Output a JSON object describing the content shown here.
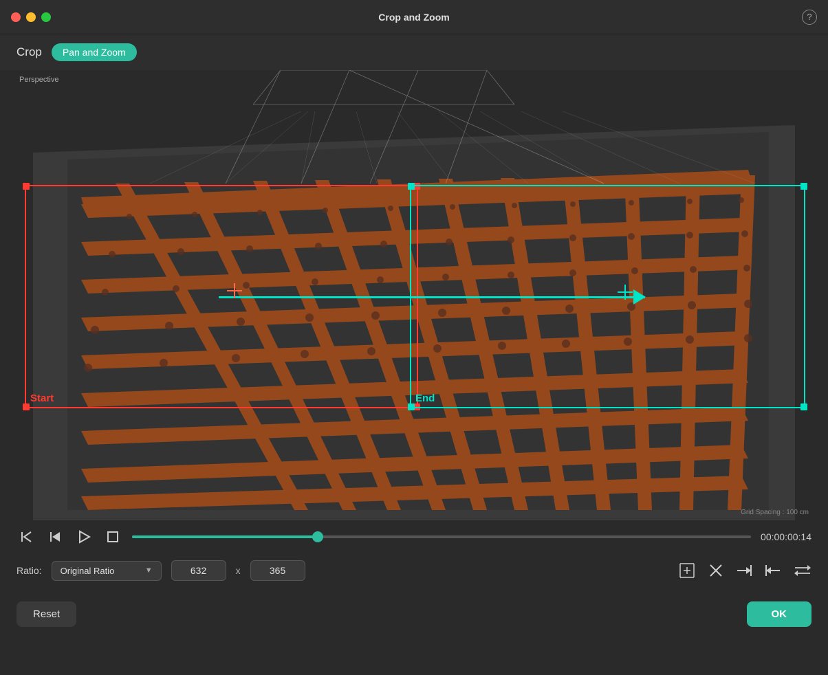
{
  "titlebar": {
    "title": "Crop and Zoom",
    "help_icon": "?"
  },
  "tabs": {
    "crop_label": "Crop",
    "panzoom_label": "Pan and Zoom"
  },
  "viewport": {
    "label": "Perspective",
    "grid_spacing": "Grid Spacing : 100 cm",
    "start_label": "Start",
    "end_label": "End"
  },
  "playback": {
    "rewind_icon": "⇐",
    "step_back_icon": "⊳|",
    "play_icon": "▷",
    "stop_icon": "□",
    "time": "00:00:00:14",
    "progress_pct": 30
  },
  "ratio": {
    "label": "Ratio:",
    "selected": "Original Ratio",
    "width": "632",
    "height": "365",
    "x_separator": "x"
  },
  "ratio_icons": {
    "maximize": "⊠",
    "close": "✕",
    "align_right": "⇥",
    "align_left": "⇤",
    "swap": "⇄"
  },
  "buttons": {
    "reset_label": "Reset",
    "ok_label": "OK"
  }
}
